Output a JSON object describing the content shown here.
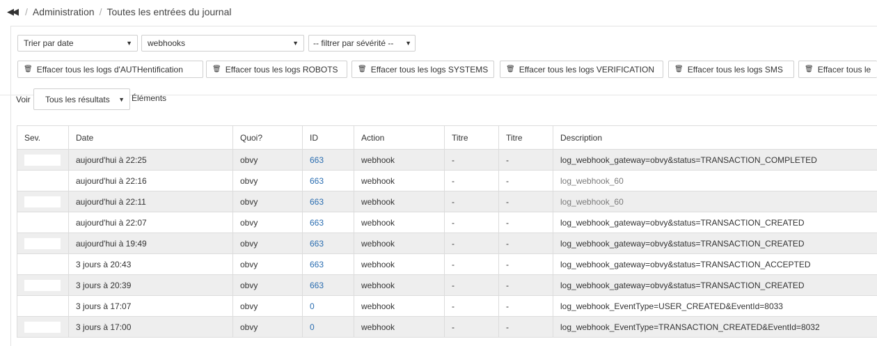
{
  "breadcrumb": {
    "back_icon": "double-chevron-left-icon",
    "separator": "/",
    "items": [
      "Administration",
      "Toutes les entrées du journal"
    ]
  },
  "filters": {
    "sort": {
      "value": "Trier par date"
    },
    "category": {
      "value": "webhooks"
    },
    "severity": {
      "value": "-- filtrer par sévérité --"
    }
  },
  "clear_buttons": [
    {
      "label": "Effacer tous les logs d'AUTHentification",
      "icon": "trash-icon"
    },
    {
      "label": "Effacer tous les logs ROBOTS",
      "icon": "trash-icon"
    },
    {
      "label": "Effacer tous les logs SYSTEMS",
      "icon": "trash-icon"
    },
    {
      "label": "Effacer tous les logs VERIFICATION",
      "icon": "trash-icon"
    },
    {
      "label": "Effacer tous les logs SMS",
      "icon": "trash-icon"
    },
    {
      "label": "Effacer tous le",
      "icon": "trash-icon"
    }
  ],
  "pagination": {
    "prefix": "Voir",
    "value": "Tous les résultats",
    "suffix": "Éléments"
  },
  "table": {
    "headers": [
      "Sev.",
      "Date",
      "Quoi?",
      "ID",
      "Action",
      "Titre",
      "Titre",
      "Description"
    ],
    "rows": [
      {
        "date": "aujourd'hui à 22:25",
        "what": "obvy",
        "id": "663",
        "action": "webhook",
        "title1": "-",
        "title2": "-",
        "description": "log_webhook_gateway=obvy&status=TRANSACTION_COMPLETED"
      },
      {
        "date": "aujourd'hui à 22:16",
        "what": "obvy",
        "id": "663",
        "action": "webhook",
        "title1": "-",
        "title2": "-",
        "description": "log_webhook_60"
      },
      {
        "date": "aujourd'hui à 22:11",
        "what": "obvy",
        "id": "663",
        "action": "webhook",
        "title1": "-",
        "title2": "-",
        "description": "log_webhook_60"
      },
      {
        "date": "aujourd'hui à 22:07",
        "what": "obvy",
        "id": "663",
        "action": "webhook",
        "title1": "-",
        "title2": "-",
        "description": "log_webhook_gateway=obvy&status=TRANSACTION_CREATED"
      },
      {
        "date": "aujourd'hui à 19:49",
        "what": "obvy",
        "id": "663",
        "action": "webhook",
        "title1": "-",
        "title2": "-",
        "description": "log_webhook_gateway=obvy&status=TRANSACTION_CREATED"
      },
      {
        "date": "3 jours à 20:43",
        "what": "obvy",
        "id": "663",
        "action": "webhook",
        "title1": "-",
        "title2": "-",
        "description": "log_webhook_gateway=obvy&status=TRANSACTION_ACCEPTED"
      },
      {
        "date": "3 jours à 20:39",
        "what": "obvy",
        "id": "663",
        "action": "webhook",
        "title1": "-",
        "title2": "-",
        "description": "log_webhook_gateway=obvy&status=TRANSACTION_CREATED"
      },
      {
        "date": "3 jours à 17:07",
        "what": "obvy",
        "id": "0",
        "action": "webhook",
        "title1": "-",
        "title2": "-",
        "description": "log_webhook_EventType=USER_CREATED&EventId=8033"
      },
      {
        "date": "3 jours à 17:00",
        "what": "obvy",
        "id": "0",
        "action": "webhook",
        "title1": "-",
        "title2": "-",
        "description": "log_webhook_EventType=TRANSACTION_CREATED&EventId=8032"
      }
    ]
  },
  "colors": {
    "link": "#2a6db0",
    "muted_text": "#7a7a7a",
    "stripe": "#eeeeee",
    "border": "#dcdcdc"
  }
}
